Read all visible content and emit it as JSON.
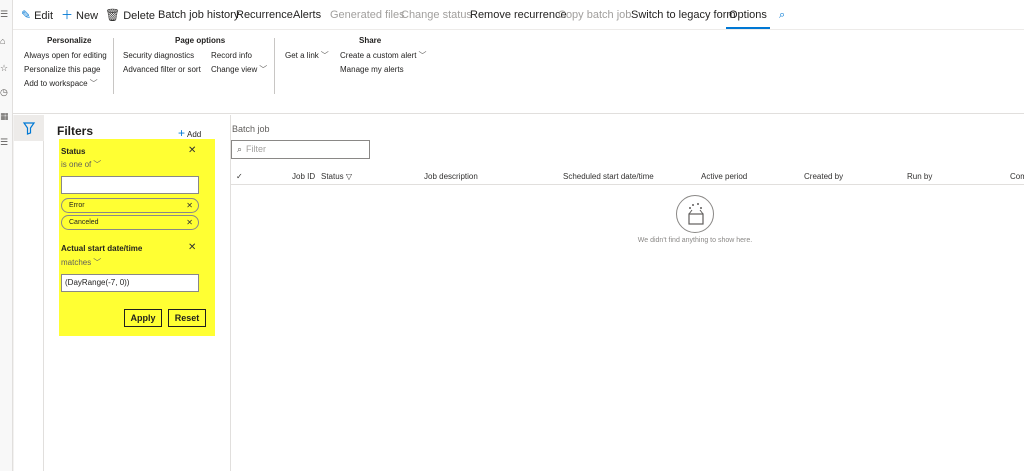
{
  "rail": {
    "icons": [
      "hamburger-icon",
      "home-icon",
      "star-icon",
      "clock-icon",
      "modules-icon",
      "list-icon"
    ],
    "glyphs": [
      "☰",
      "⌂",
      "☆",
      "◷",
      "▦",
      "☰"
    ]
  },
  "commands": {
    "edit": "Edit",
    "new": "New",
    "delete": "Delete",
    "batch_job_history": "Batch job history",
    "recurrence": "Recurrence",
    "alerts": "Alerts",
    "generated_files": "Generated files",
    "change_status": "Change status",
    "remove_recurrence": "Remove recurrence",
    "copy_batch_job": "Copy batch job",
    "switch_legacy": "Switch to legacy form",
    "options": "Options"
  },
  "ribbon": {
    "personalize": {
      "title": "Personalize",
      "always_open": "Always open for editing",
      "personalize_page": "Personalize this page",
      "add_workspace": "Add to workspace"
    },
    "page_options": {
      "title": "Page options",
      "security": "Security diagnostics",
      "advanced_filter": "Advanced filter or sort",
      "record_info": "Record info",
      "change_view": "Change view"
    },
    "share": {
      "title": "Share",
      "get_link": "Get a link",
      "create_alert": "Create a custom alert",
      "manage_alerts": "Manage my alerts"
    }
  },
  "filters": {
    "title": "Filters",
    "add": "Add",
    "status": {
      "label": "Status",
      "operator": "is one of",
      "input_value": "",
      "chips": [
        "Error",
        "Canceled"
      ]
    },
    "start_date": {
      "label": "Actual start date/time",
      "operator": "matches",
      "value": "(DayRange(-7, 0))"
    },
    "apply": "Apply",
    "reset": "Reset"
  },
  "grid": {
    "title": "Batch job",
    "filter_placeholder": "Filter",
    "columns": {
      "job_id": "Job ID",
      "status": "Status",
      "job_description": "Job description",
      "scheduled_start": "Scheduled start date/time",
      "active_period": "Active period",
      "created_by": "Created by",
      "run_by": "Run by",
      "company": "Com"
    },
    "empty_message": "We didn't find anything to show here."
  },
  "colors": {
    "accent": "#0078d4",
    "highlight": "#ffff33"
  }
}
